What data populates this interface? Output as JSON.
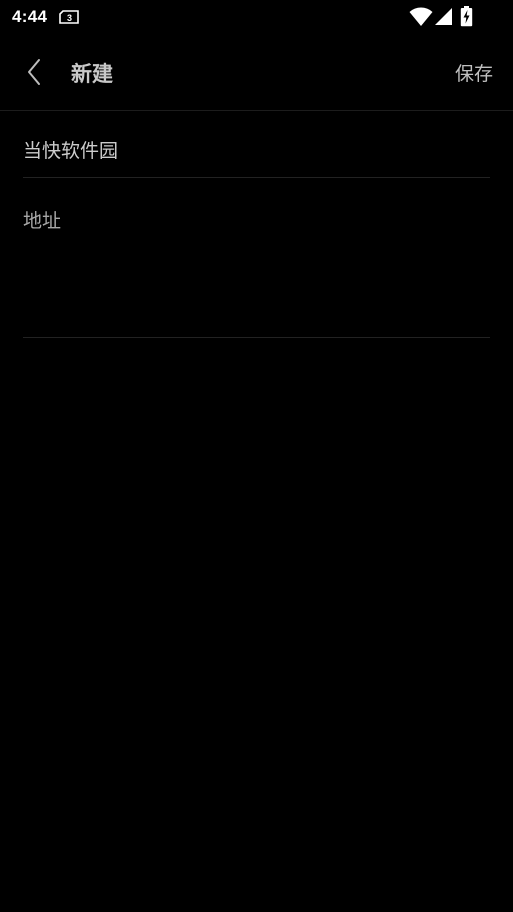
{
  "status_bar": {
    "time": "4:44",
    "icons": [
      "sim-card-icon",
      "wifi-icon",
      "cell-signal-icon",
      "battery-charging-icon"
    ]
  },
  "toolbar": {
    "title": "新建",
    "save_label": "保存",
    "back_icon": "chevron-left-icon"
  },
  "form": {
    "name_value": "当快软件园",
    "address_placeholder": "地址"
  },
  "colors": {
    "background": "#000000",
    "text_primary": "#cccccc",
    "text_hint": "#a8a8a8",
    "divider": "#222222"
  }
}
